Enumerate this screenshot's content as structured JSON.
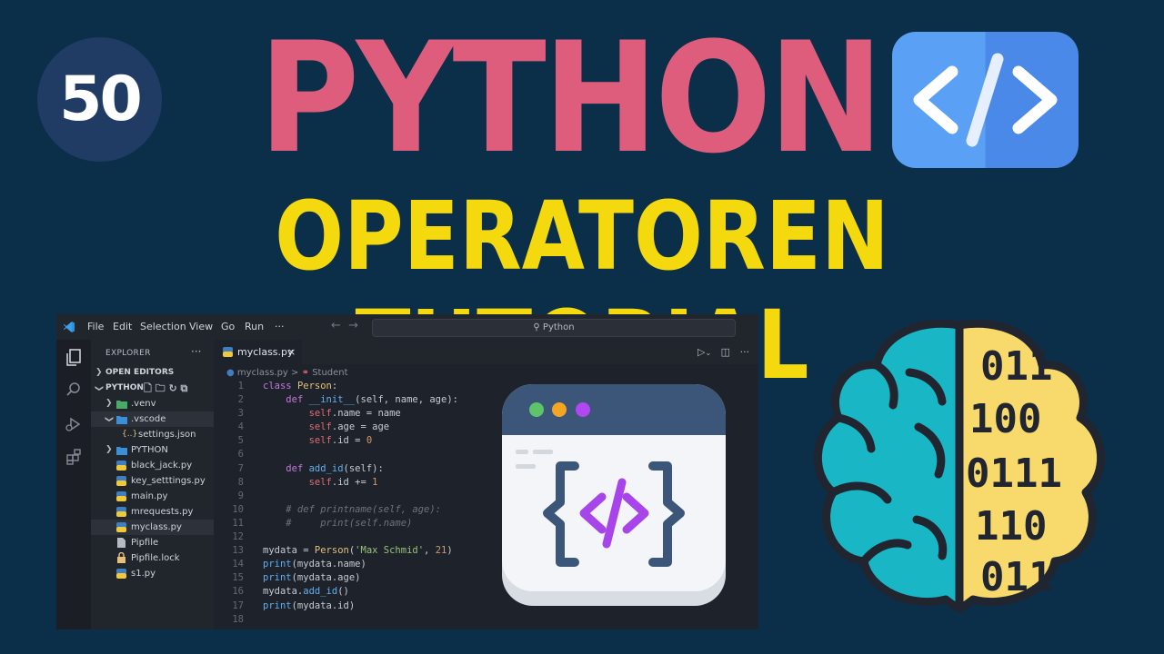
{
  "badge": {
    "number": "50"
  },
  "titles": {
    "main": "PYTHON",
    "sub": "OPERATOREN TUTORIAL"
  },
  "colors": {
    "background": "#0c2f49",
    "main_title": "#df5d7c",
    "sub_title": "#f5d90f",
    "badge": "#203c64"
  },
  "editor": {
    "menu": [
      "File",
      "Edit",
      "Selection",
      "View",
      "Go",
      "Run",
      "···"
    ],
    "search": "Python",
    "explorer": {
      "title": "EXPLORER",
      "open_editors": "OPEN EDITORS",
      "folder": "PYTHON",
      "items": [
        {
          "label": ".venv",
          "kind": "folder"
        },
        {
          "label": ".vscode",
          "kind": "folder-open"
        },
        {
          "label": "settings.json",
          "kind": "json"
        },
        {
          "label": "PYTHON",
          "kind": "folder"
        },
        {
          "label": "black_jack.py",
          "kind": "py"
        },
        {
          "label": "key_setttings.py",
          "kind": "py"
        },
        {
          "label": "main.py",
          "kind": "py"
        },
        {
          "label": "mrequests.py",
          "kind": "py"
        },
        {
          "label": "myclass.py",
          "kind": "py"
        },
        {
          "label": "Pipfile",
          "kind": "file"
        },
        {
          "label": "Pipfile.lock",
          "kind": "lock"
        },
        {
          "label": "s1.py",
          "kind": "py"
        }
      ]
    },
    "tab": {
      "label": "myclass.py",
      "close": "×"
    },
    "breadcrumb": {
      "file": "myclass.py",
      "separator": ">",
      "symbol": "Student"
    },
    "code_lines": [
      {
        "n": "1",
        "text": "class Person:"
      },
      {
        "n": "2",
        "text": "    def __init__(self, name, age):"
      },
      {
        "n": "3",
        "text": "        self.name = name"
      },
      {
        "n": "4",
        "text": "        self.age = age"
      },
      {
        "n": "5",
        "text": "        self.id = 0"
      },
      {
        "n": "6",
        "text": ""
      },
      {
        "n": "7",
        "text": "    def add_id(self):"
      },
      {
        "n": "8",
        "text": "        self.id += 1"
      },
      {
        "n": "9",
        "text": ""
      },
      {
        "n": "10",
        "text": "    # def printname(self, age):"
      },
      {
        "n": "11",
        "text": "    #     print(self.name)"
      },
      {
        "n": "12",
        "text": ""
      },
      {
        "n": "13",
        "text": "mydata = Person('Max Schmid', 21)"
      },
      {
        "n": "14",
        "text": "print(mydata.name)"
      },
      {
        "n": "15",
        "text": "print(mydata.age)"
      },
      {
        "n": "16",
        "text": "mydata.add_id()"
      },
      {
        "n": "17",
        "text": "print(mydata.id)"
      },
      {
        "n": "18",
        "text": ""
      }
    ]
  },
  "illustrations": {
    "code_badge": "code-brackets-icon",
    "window": "browser-code-window-icon",
    "brain": "binary-brain-icon",
    "brain_binary": [
      "011",
      "100",
      "0111",
      "110",
      "011"
    ]
  }
}
